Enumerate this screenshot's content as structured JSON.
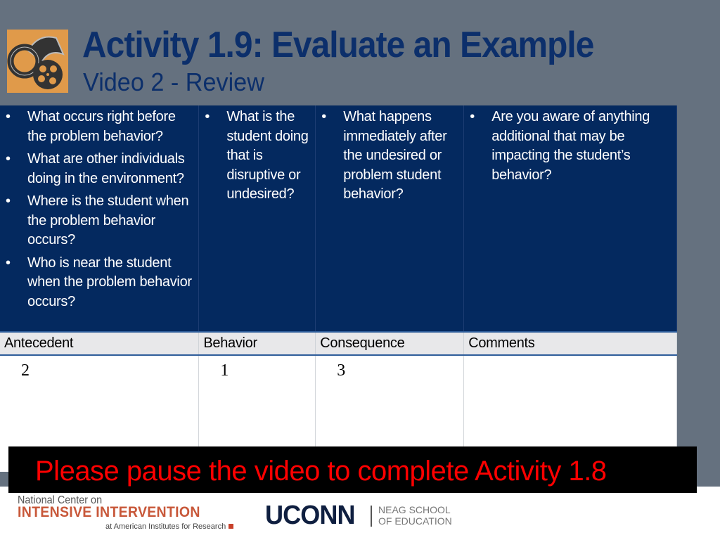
{
  "header": {
    "logo_icon": "film-reel-icon",
    "title": "Activity 1.9: Evaluate an Example",
    "subtitle": "Video 2 - Review"
  },
  "table": {
    "questions": [
      [
        "What occurs right before the problem behavior?",
        "What are other individuals doing in the environment?",
        "Where is the student when the problem behavior occurs?",
        "Who is near the student when the problem behavior occurs?"
      ],
      [
        "What is the student doing that is disruptive or undesired?"
      ],
      [
        "What happens immediately after the undesired or problem student behavior?"
      ],
      [
        "Are you aware of anything additional that may be impacting the student’s behavior?"
      ]
    ],
    "headers": [
      "Antecedent",
      "Behavior",
      "Consequence",
      "Comments"
    ],
    "values": [
      "2",
      "1",
      "3",
      ""
    ]
  },
  "banner": {
    "text": "Please pause the video to complete Activity 1.8",
    "color": "#ff0000"
  },
  "footer": {
    "ncii_line1": "National Center on",
    "ncii_line2": "INTENSIVE INTERVENTION",
    "ncii_line3": "at American Institutes for Research",
    "uconn": "UCONN",
    "neag_line1": "NEAG SCHOOL",
    "neag_line2": "OF EDUCATION"
  }
}
